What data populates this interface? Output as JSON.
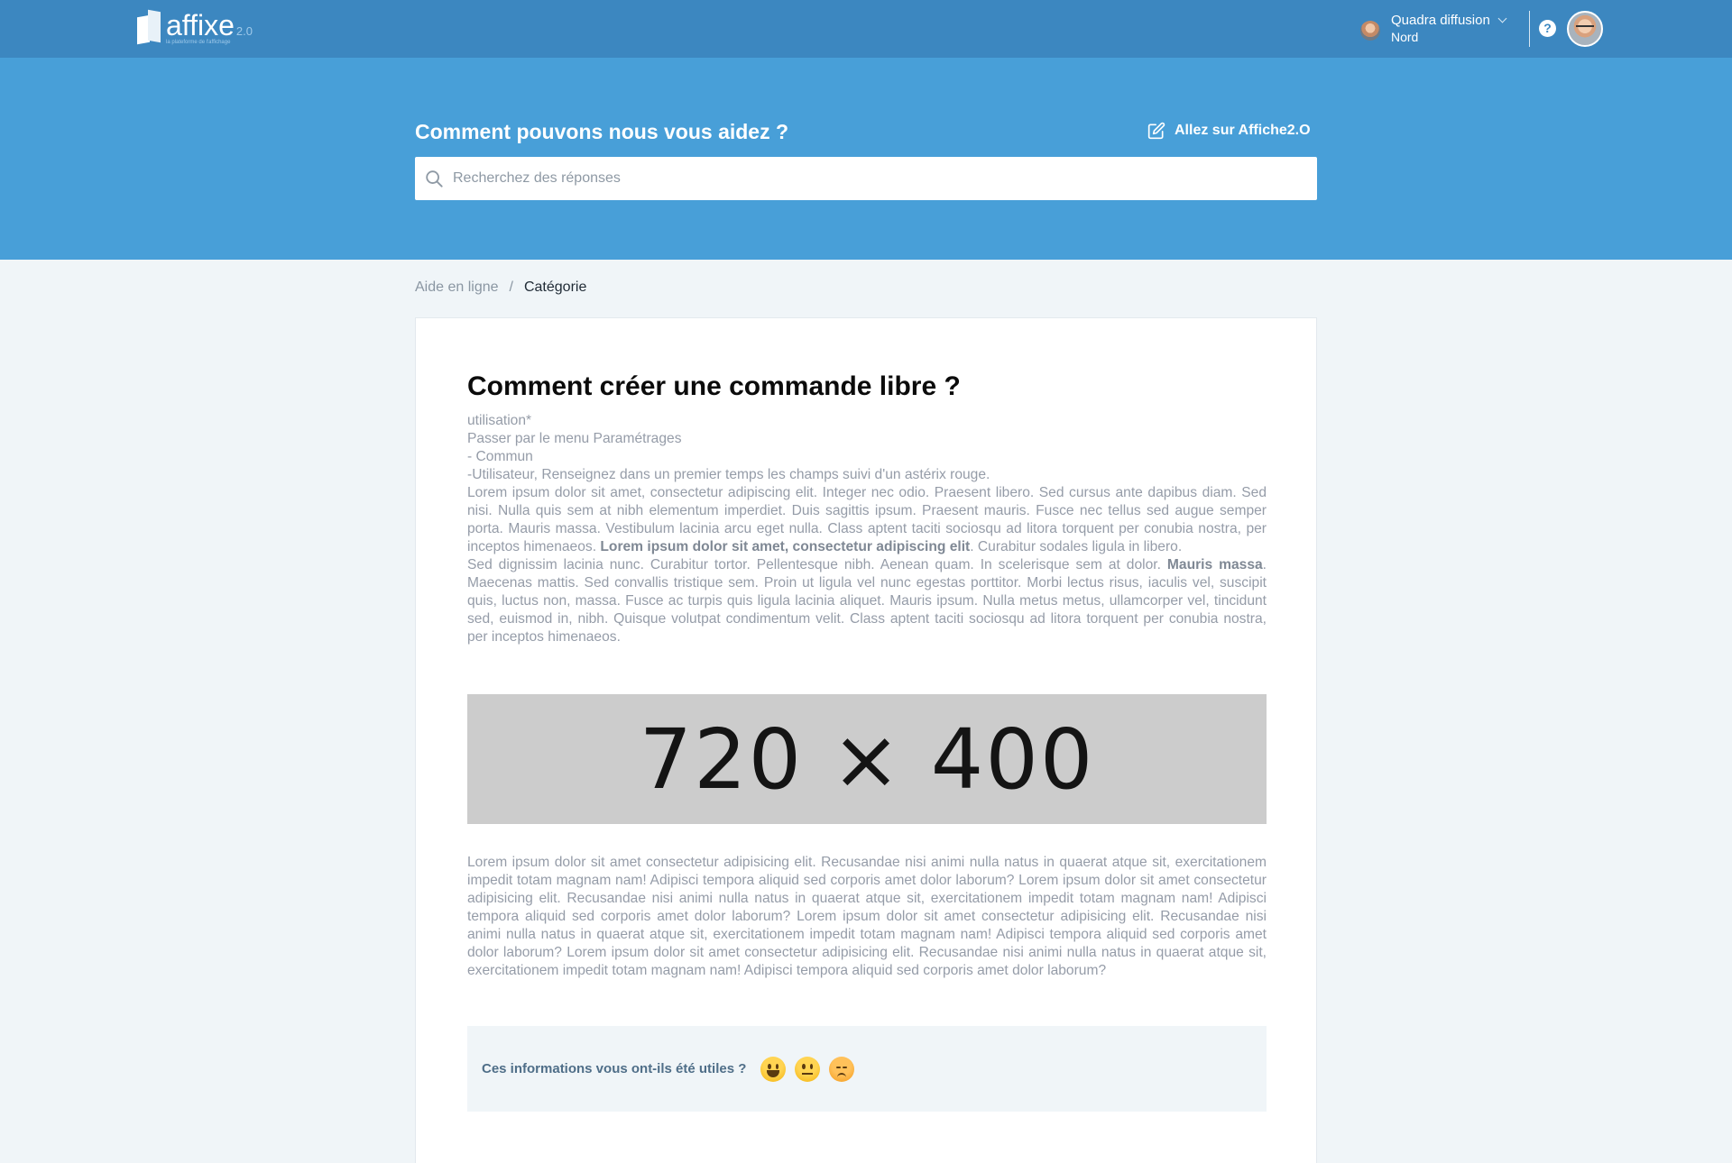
{
  "brand": {
    "name": "affixe",
    "version": "2.0",
    "tagline": "la plateforme de l'affichage"
  },
  "account": {
    "org_name": "Quadra diffusion",
    "region": "Nord"
  },
  "hero": {
    "title": "Comment pouvons nous vous aidez ?",
    "link_label": "Allez sur Affiche2.O",
    "search_placeholder": "Recherchez des réponses",
    "background": "#489fd8"
  },
  "topbar": {
    "background": "#3c87c0"
  },
  "icons": {
    "search": "search-icon",
    "edit": "edit-icon",
    "help": "help-circle-icon",
    "chevron": "chevron-down-icon"
  },
  "breadcrumb": {
    "root": "Aide en ligne",
    "separator": "/",
    "current": "Catégorie"
  },
  "article": {
    "title": "Comment créer une commande libre ?",
    "lines": [
      "utilisation*",
      "Passer par le menu Paramétrages",
      "- Commun",
      "-Utilisateur, Renseignez dans un premier temps les champs suivi d'un astérix rouge."
    ],
    "para1_a": "Lorem ipsum dolor sit amet, consectetur adipiscing elit. Integer nec odio. Praesent libero. Sed cursus ante dapibus diam. Sed nisi. Nulla quis sem at nibh elementum imperdiet. Duis sagittis ipsum. Praesent mauris. Fusce nec tellus sed augue semper porta. Mauris massa. Vestibulum lacinia arcu eget nulla. Class aptent taciti sociosqu ad litora torquent per conubia nostra, per inceptos himenaeos.",
    "para1_bold": "Lorem ipsum dolor sit amet, consectetur adipiscing elit",
    "para1_b": ". Curabitur sodales ligula in libero.",
    "para2_a": "Sed dignissim lacinia nunc. Curabitur tortor. Pellentesque nibh. Aenean quam. In scelerisque sem at dolor.",
    "para2_bold": "Mauris massa",
    "para2_b": ". Maecenas mattis. Sed convallis tristique sem. Proin ut ligula vel nunc egestas porttitor. Morbi lectus risus, iaculis vel, suscipit quis, luctus non, massa. Fusce ac turpis quis ligula lacinia aliquet. Mauris ipsum. Nulla metus metus, ullamcorper vel, tincidunt sed, euismod in, nibh. Quisque volutpat condimentum velit. Class aptent taciti sociosqu ad litora torquent per conubia nostra, per inceptos himenaeos.",
    "image_label": "720 × 400",
    "para3": "Lorem ipsum dolor sit amet consectetur adipisicing elit. Recusandae nisi animi nulla natus in quaerat atque sit, exercitationem impedit totam magnam nam! Adipisci tempora aliquid sed corporis amet dolor laborum? Lorem ipsum dolor sit amet consectetur adipisicing elit. Recusandae nisi animi nulla natus in quaerat atque sit, exercitationem impedit totam magnam nam! Adipisci tempora aliquid sed corporis amet dolor laborum? Lorem ipsum dolor sit amet consectetur adipisicing elit. Recusandae nisi animi nulla natus in quaerat atque sit, exercitationem impedit totam magnam nam! Adipisci tempora aliquid sed corporis amet dolor laborum? Lorem ipsum dolor sit amet consectetur adipisicing elit. Recusandae nisi animi nulla natus in quaerat atque sit, exercitationem impedit totam magnam nam! Adipisci tempora aliquid sed corporis amet dolor laborum?"
  },
  "feedback": {
    "question": "Ces informations vous ont-ils été utiles ?",
    "options": [
      "smiley-happy-icon",
      "smiley-neutral-icon",
      "smiley-sad-icon"
    ]
  }
}
